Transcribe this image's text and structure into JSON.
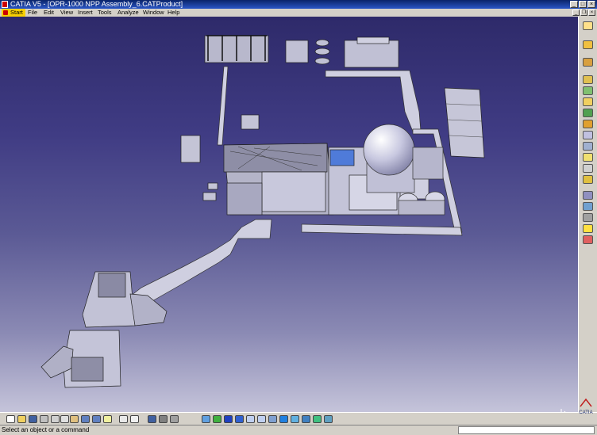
{
  "window": {
    "title": "CATIA V5 - [OPR-1000 NPP Assembly_6.CATProduct]"
  },
  "menu": {
    "items": [
      {
        "label": "Start"
      },
      {
        "label": "File"
      },
      {
        "label": "Edit"
      },
      {
        "label": "View"
      },
      {
        "label": "Insert"
      },
      {
        "label": "Tools"
      },
      {
        "label": "Analyze"
      },
      {
        "label": "Window"
      },
      {
        "label": "Help"
      }
    ]
  },
  "brand": {
    "logo_text": "CATIA"
  },
  "status": {
    "message": "Select an object or a command",
    "command_value": ""
  },
  "right_toolbar": {
    "icons": [
      "select-arrow-icon",
      "sketcher-icon",
      "assembly-icon",
      "part-design-icon",
      "constraint-icon",
      "manipulate-icon",
      "snap-icon",
      "explode-icon",
      "clash-icon",
      "sectioning-icon",
      "measure-icon",
      "scene-icon",
      "catalog-icon",
      "annotation-icon",
      "space-analysis-icon",
      "render-icon",
      "lightbulb-icon",
      "close-tool-icon"
    ]
  },
  "bottom_toolbar": {
    "icons": [
      "new-icon",
      "open-icon",
      "save-icon",
      "print-icon",
      "cut-icon",
      "copy-icon",
      "paste-icon",
      "undo-icon",
      "redo-icon",
      "whats-this-icon",
      "formula-icon",
      "comment-icon",
      "knowledge-icon",
      "catalog-browser-icon",
      "publication-icon",
      "fly-mode-icon",
      "fit-all-icon",
      "pan-icon",
      "rotate-icon",
      "zoom-in-icon",
      "zoom-out-icon",
      "normal-view-icon",
      "multi-view-icon",
      "quick-view-icon",
      "shading-icon",
      "hide-show-icon",
      "swap-space-icon"
    ]
  }
}
